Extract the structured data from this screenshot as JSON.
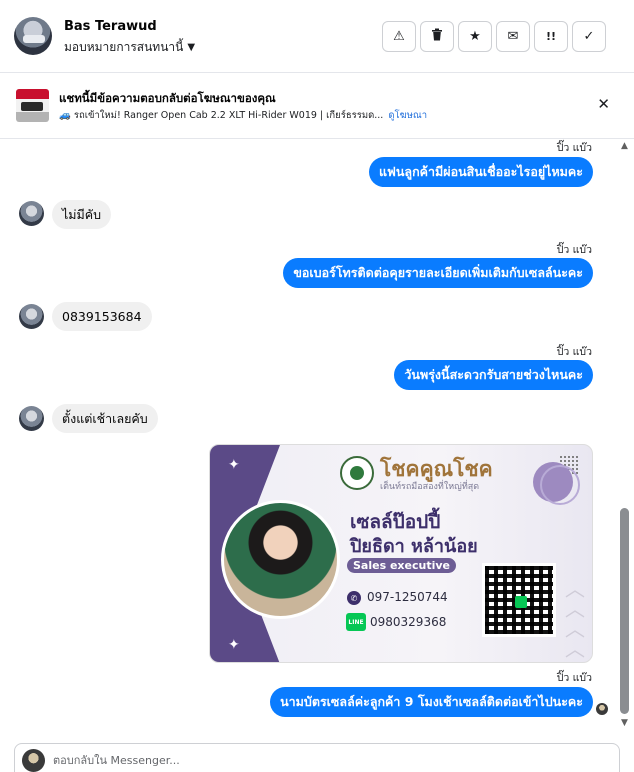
{
  "header": {
    "name": "Bas Terawud",
    "assign_label": "มอบหมายการสนทนานี้",
    "actions": [
      {
        "name": "warning-icon",
        "glyph": "⚠"
      },
      {
        "name": "trash-icon",
        "glyph": "🗑"
      },
      {
        "name": "star-icon",
        "glyph": "★"
      },
      {
        "name": "mail-icon",
        "glyph": "✉"
      },
      {
        "name": "follow-up-icon",
        "glyph": "!!"
      },
      {
        "name": "check-icon",
        "glyph": "✓"
      }
    ]
  },
  "ad": {
    "title": "แชทนี้มีข้อความตอบกลับต่อโฆษณาของคุณ",
    "description": "🚙 รถเข้าใหม่! Ranger Open Cab 2.2 XLT Hi-Rider W019 | เกียร์ธรรมด...",
    "link": "ดูโฆษณา",
    "close": "✕"
  },
  "messages": {
    "m1": {
      "seen": "ปิ๊ว แบ๊ว",
      "text": "แฟนลูกค้ามีผ่อนสินเชื่ออะไรอยู่ไหมคะ"
    },
    "m2": {
      "text": "ไม่มีคับ"
    },
    "m3": {
      "seen": "ปิ๊ว แบ๊ว",
      "text": "ขอเบอร์โทรติดต่อคุยรายละเอียดเพิ่มเติมกับเซลล์นะคะ"
    },
    "m4": {
      "text": "0839153684"
    },
    "m5": {
      "seen": "ปิ๊ว แบ๊ว",
      "text": "วันพรุ่งนี้สะดวกรับสายช่วงไหนคะ"
    },
    "m6": {
      "text": "ตั้งแต่เช้าเลยคับ"
    },
    "m7": {
      "seen": "ปิ๊ว แบ๊ว",
      "text": "นามบัตรเซลล์ค่ะลูกค้า  9 โมงเช้าเซลล์ติดต่อเข้าไปนะคะ"
    }
  },
  "card": {
    "brand": "โชคคูณโชค",
    "tagline": "เต็นท์รถมือสองที่ใหญ่ที่สุด",
    "nickname": "เซลล์ป๊อปปี้",
    "name": "ปิยธิดา หล้าน้อย",
    "role": "Sales executive",
    "phone": "097-1250744",
    "line_label": "LINE",
    "line_id": "0980329368"
  },
  "reply": {
    "placeholder": "ตอบกลับใน Messenger..."
  }
}
